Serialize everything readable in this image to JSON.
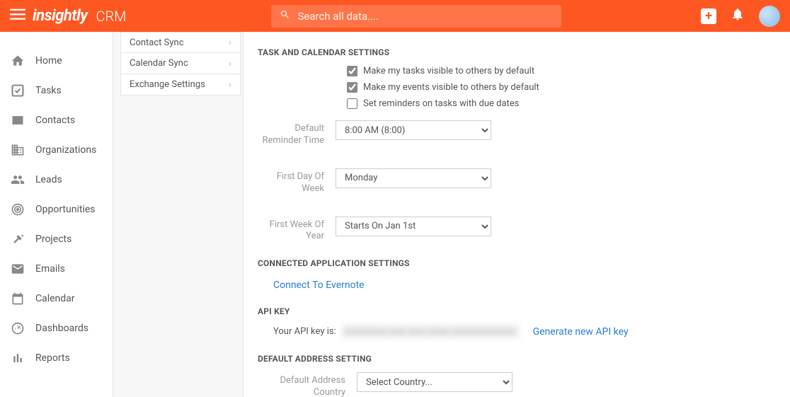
{
  "header": {
    "logo": "insightly",
    "product": "CRM",
    "search_placeholder": "Search all data...."
  },
  "nav": {
    "items": [
      {
        "label": "Home"
      },
      {
        "label": "Tasks"
      },
      {
        "label": "Contacts"
      },
      {
        "label": "Organizations"
      },
      {
        "label": "Leads"
      },
      {
        "label": "Opportunities"
      },
      {
        "label": "Projects"
      },
      {
        "label": "Emails"
      },
      {
        "label": "Calendar"
      },
      {
        "label": "Dashboards"
      },
      {
        "label": "Reports"
      }
    ]
  },
  "subnav": {
    "items": [
      {
        "label": "Contact Sync"
      },
      {
        "label": "Calendar Sync"
      },
      {
        "label": "Exchange Settings"
      }
    ]
  },
  "sections": {
    "task_calendar_header": "TASK AND CALENDAR SETTINGS",
    "checkboxes": {
      "tasks_visible": "Make my tasks visible to others by default",
      "events_visible": "Make my events visible to others by default",
      "reminders": "Set reminders on tasks with due dates"
    },
    "fields": {
      "reminder_time_label": "Default Reminder Time",
      "reminder_time_value": "8:00 AM (8:00)",
      "first_day_label": "First Day Of Week",
      "first_day_value": "Monday",
      "first_week_label": "First Week Of Year",
      "first_week_value": "Starts On Jan 1st"
    },
    "connected_header": "CONNECTED APPLICATION SETTINGS",
    "connect_evernote": "Connect To Evernote",
    "api_header": "API KEY",
    "api_label": "Your API key is:",
    "api_value": "xxxxxxxx-xxx-xxx-xxxx-xxxxxxxxxxxx",
    "generate_link": "Generate new API key",
    "address_header": "DEFAULT ADDRESS SETTING",
    "address_label": "Default Address Country",
    "address_value": "Select Country..."
  }
}
